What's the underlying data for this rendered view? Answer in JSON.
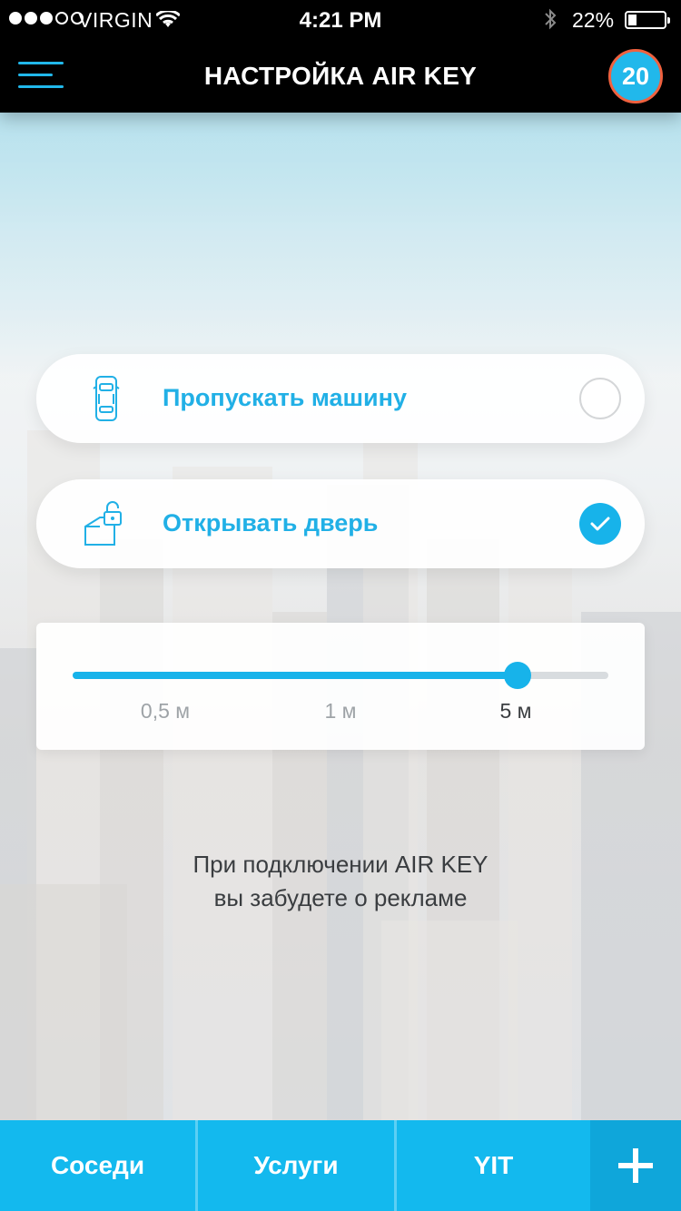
{
  "status_bar": {
    "carrier": "VIRGIN",
    "time": "4:21 PM",
    "battery_percent": "22%",
    "signal_bars_filled": 3,
    "signal_bars_total": 5,
    "icons": [
      "wifi-icon",
      "bluetooth-icon",
      "battery-icon"
    ]
  },
  "nav": {
    "title": "НАСТРОЙКА AIR KEY",
    "badge_count": "20",
    "menu_icon": "hamburger-menu-icon"
  },
  "options": [
    {
      "label": "Пропускать машину",
      "icon": "car-icon",
      "selected": false
    },
    {
      "label": "Открывать дверь",
      "icon": "door-lock-icon",
      "selected": true
    }
  ],
  "distance": {
    "ticks": [
      "0,5 м",
      "1 м",
      "5 м"
    ],
    "selected_index": 2,
    "value_fraction": 0.83
  },
  "info": {
    "line1": "При подключении AIR KEY",
    "line2": "вы забудете о рекламе"
  },
  "tabs": {
    "items": [
      "Соседи",
      "Услуги",
      "YIT"
    ],
    "add_icon": "plus-icon"
  },
  "colors": {
    "accent": "#17b3ea",
    "badge_border": "#f0613f",
    "bar": "#000000"
  }
}
